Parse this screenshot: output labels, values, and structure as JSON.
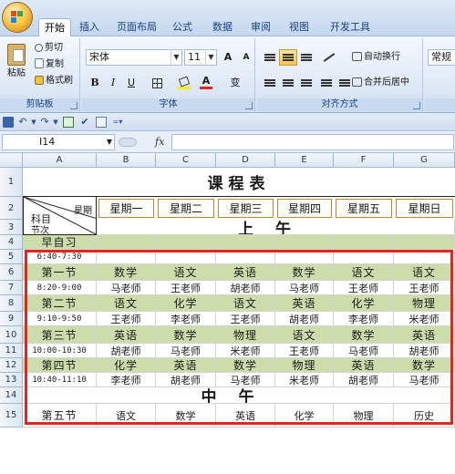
{
  "ribbon": {
    "tabs": [
      "开始",
      "插入",
      "页面布局",
      "公式",
      "数据",
      "审阅",
      "视图",
      "开发工具"
    ],
    "active_tab": "开始",
    "clipboard": {
      "paste": "粘贴",
      "cut": "剪切",
      "copy": "复制",
      "format_painter": "格式刷",
      "label": "剪贴板"
    },
    "font": {
      "name": "宋体",
      "size": "11",
      "grow": "A",
      "shrink": "A",
      "bold": "B",
      "italic": "I",
      "underline": "U",
      "color_a": "A",
      "phonetic": "变",
      "label": "字体"
    },
    "alignment": {
      "wrap": "自动换行",
      "merge": "合并后居中",
      "label": "对齐方式"
    },
    "number": {
      "format": "常规"
    }
  },
  "formula_bar": {
    "name_box": "I14",
    "fx": "fx",
    "content": ""
  },
  "columns": [
    "A",
    "B",
    "C",
    "D",
    "E",
    "F",
    "G"
  ],
  "rows": [
    "1",
    "2",
    "3",
    "4",
    "5",
    "6",
    "7",
    "8",
    "9",
    "10",
    "11",
    "12",
    "13",
    "14",
    "15"
  ],
  "sheet": {
    "title": "课程表",
    "header_top": "星期",
    "header_left": "科目",
    "section_label": "节次",
    "days": [
      "星期一",
      "星期二",
      "星期三",
      "星期四",
      "星期五",
      "星期日"
    ],
    "morning": "上午",
    "afternoon": "中午",
    "schedule": [
      {
        "period": "早自习",
        "time": "6:40-7:30",
        "subjects": [
          "",
          "",
          "",
          "",
          "",
          ""
        ],
        "teachers": [
          "",
          "",
          "",
          "",
          "",
          ""
        ]
      },
      {
        "period": "第一节",
        "time": "8:20-9:00",
        "subjects": [
          "数学",
          "语文",
          "英语",
          "数学",
          "语文",
          "语文"
        ],
        "teachers": [
          "马老师",
          "王老师",
          "胡老师",
          "马老师",
          "王老师",
          "王老师"
        ]
      },
      {
        "period": "第二节",
        "time": "9:10-9:50",
        "subjects": [
          "语文",
          "化学",
          "语文",
          "英语",
          "化学",
          "物理"
        ],
        "teachers": [
          "王老师",
          "李老师",
          "王老师",
          "胡老师",
          "李老师",
          "米老师"
        ]
      },
      {
        "period": "第三节",
        "time": "10:00-10:30",
        "subjects": [
          "英语",
          "数学",
          "物理",
          "语文",
          "数学",
          "英语"
        ],
        "teachers": [
          "胡老师",
          "马老师",
          "米老师",
          "王老师",
          "马老师",
          "胡老师"
        ]
      },
      {
        "period": "第四节",
        "time": "10:40-11:10",
        "subjects": [
          "化学",
          "英语",
          "数学",
          "物理",
          "英语",
          "数学"
        ],
        "teachers": [
          "李老师",
          "胡老师",
          "马老师",
          "米老师",
          "胡老师",
          "马老师"
        ]
      }
    ],
    "row15": {
      "period": "第五节",
      "subjects": [
        "语文",
        "数学",
        "英语",
        "化学",
        "物理",
        "历史"
      ]
    }
  }
}
